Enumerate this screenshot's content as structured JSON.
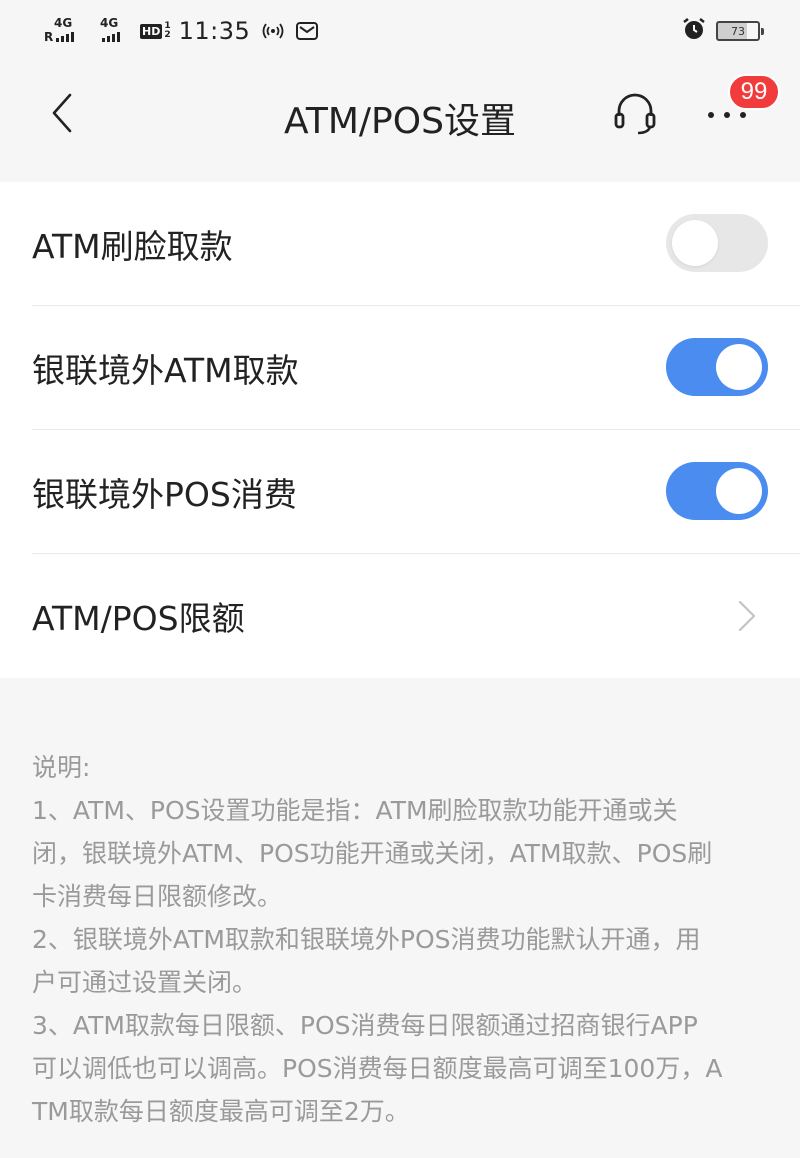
{
  "status_bar": {
    "sim1_network": "4G",
    "sim1_roaming": "R",
    "sim2_network": "4G",
    "hd_label": "HD",
    "hd_sim_top": "1",
    "hd_sim_bottom": "2",
    "time": "11:35",
    "battery_level": "73"
  },
  "nav": {
    "title": "ATM/POS设置",
    "notification_badge": "99"
  },
  "settings": {
    "items": [
      {
        "label": "ATM刷脸取款",
        "control": "toggle",
        "enabled": false
      },
      {
        "label": "银联境外ATM取款",
        "control": "toggle",
        "enabled": true
      },
      {
        "label": "银联境外POS消费",
        "control": "toggle",
        "enabled": true
      },
      {
        "label": "ATM/POS限额",
        "control": "chevron"
      }
    ]
  },
  "notes": {
    "heading": "说明:",
    "lines": [
      "1、ATM、POS设置功能是指：ATM刷脸取款功能开通或关",
      "闭，银联境外ATM、POS功能开通或关闭，ATM取款、POS刷",
      "卡消费每日限额修改。",
      "2、银联境外ATM取款和银联境外POS消费功能默认开通，用",
      "户可通过设置关闭。",
      "3、ATM取款每日限额、POS消费每日限额通过招商银行APP",
      "可以调低也可以调高。POS消费每日额度最高可调至100万，A",
      "TM取款每日额度最高可调至2万。"
    ]
  },
  "colors": {
    "toggle_on": "#4a8cf0",
    "toggle_off": "#e7e7e7",
    "badge": "#f23c3c",
    "note_text": "#9a9a9a"
  }
}
